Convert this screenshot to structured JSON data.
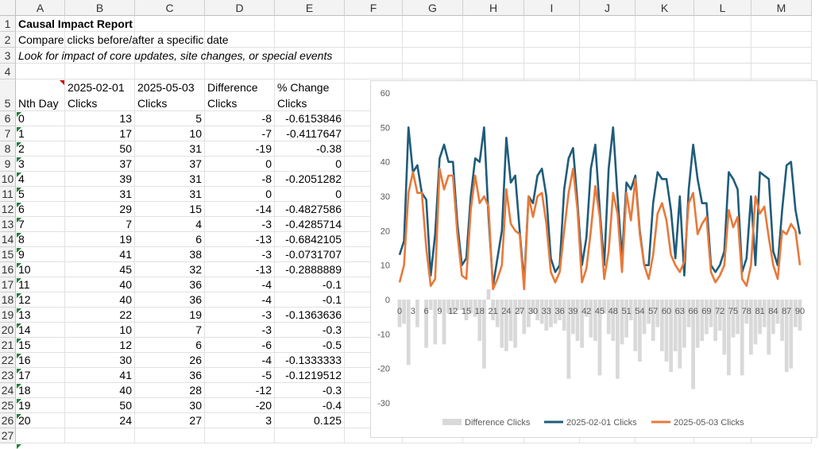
{
  "columns": [
    "A",
    "B",
    "C",
    "D",
    "E",
    "F",
    "G",
    "H",
    "I",
    "J",
    "K",
    "L",
    "M"
  ],
  "rows": {
    "title": "Causal Impact Report",
    "subtitle": "Compare clicks before/after a specific date",
    "note": "Look for impact of core updates, site changes, or special events"
  },
  "table": {
    "headers": [
      {
        "line1": "",
        "line2": "Nth Day"
      },
      {
        "line1": "2025-02-01",
        "line2": "Clicks"
      },
      {
        "line1": "2025-05-03",
        "line2": "Clicks"
      },
      {
        "line1": "Difference",
        "line2": "Clicks"
      },
      {
        "line1": "% Change",
        "line2": "Clicks"
      }
    ],
    "data": [
      [
        "0",
        "13",
        "5",
        "-8",
        "-0.6153846"
      ],
      [
        "1",
        "17",
        "10",
        "-7",
        "-0.4117647"
      ],
      [
        "2",
        "50",
        "31",
        "-19",
        "-0.38"
      ],
      [
        "3",
        "37",
        "37",
        "0",
        "0"
      ],
      [
        "4",
        "39",
        "31",
        "-8",
        "-0.2051282"
      ],
      [
        "5",
        "31",
        "31",
        "0",
        "0"
      ],
      [
        "6",
        "29",
        "15",
        "-14",
        "-0.4827586"
      ],
      [
        "7",
        "7",
        "4",
        "-3",
        "-0.4285714"
      ],
      [
        "8",
        "19",
        "6",
        "-13",
        "-0.6842105"
      ],
      [
        "9",
        "41",
        "38",
        "-3",
        "-0.0731707"
      ],
      [
        "10",
        "45",
        "32",
        "-13",
        "-0.2888889"
      ],
      [
        "11",
        "40",
        "36",
        "-4",
        "-0.1"
      ],
      [
        "12",
        "40",
        "36",
        "-4",
        "-0.1"
      ],
      [
        "13",
        "22",
        "19",
        "-3",
        "-0.1363636"
      ],
      [
        "14",
        "10",
        "7",
        "-3",
        "-0.3"
      ],
      [
        "15",
        "12",
        "6",
        "-6",
        "-0.5"
      ],
      [
        "16",
        "30",
        "26",
        "-4",
        "-0.1333333"
      ],
      [
        "17",
        "41",
        "36",
        "-5",
        "-0.1219512"
      ],
      [
        "18",
        "40",
        "28",
        "-12",
        "-0.3"
      ],
      [
        "19",
        "50",
        "30",
        "-20",
        "-0.4"
      ],
      [
        "20",
        "24",
        "27",
        "3",
        "0.125"
      ]
    ]
  },
  "colors": {
    "series_a": "#1f5c7a",
    "series_b": "#e8793a",
    "diff": "#d9d9d9",
    "green_marker": "#1a7f37",
    "red_marker": "#d00000"
  },
  "chart_data": {
    "type": "line",
    "ylim": [
      -30,
      60
    ],
    "yticks": [
      "60",
      "50",
      "40",
      "30",
      "20",
      "10",
      "0",
      "-10",
      "-20",
      "-30"
    ],
    "xticks": [
      "0",
      "3",
      "6",
      "9",
      "12",
      "15",
      "18",
      "21",
      "24",
      "27",
      "30",
      "33",
      "36",
      "39",
      "42",
      "45",
      "48",
      "51",
      "54",
      "57",
      "60",
      "63",
      "66",
      "69",
      "72",
      "75",
      "78",
      "81",
      "84",
      "87",
      "90"
    ],
    "x": [
      0,
      1,
      2,
      3,
      4,
      5,
      6,
      7,
      8,
      9,
      10,
      11,
      12,
      13,
      14,
      15,
      16,
      17,
      18,
      19,
      20,
      21,
      22,
      23,
      24,
      25,
      26,
      27,
      28,
      29,
      30,
      31,
      32,
      33,
      34,
      35,
      36,
      37,
      38,
      39,
      40,
      41,
      42,
      43,
      44,
      45,
      46,
      47,
      48,
      49,
      50,
      51,
      52,
      53,
      54,
      55,
      56,
      57,
      58,
      59,
      60,
      61,
      62,
      63,
      64,
      65,
      66,
      67,
      68,
      69,
      70,
      71,
      72,
      73,
      74,
      75,
      76,
      77,
      78,
      79,
      80,
      81,
      82,
      83,
      84,
      85,
      86,
      87,
      88,
      89,
      90
    ],
    "series": [
      {
        "name": "Difference Clicks",
        "type": "bar",
        "values": [
          -8,
          -7,
          -19,
          0,
          -8,
          0,
          -14,
          -3,
          -13,
          -3,
          -13,
          -4,
          -4,
          -3,
          -3,
          -6,
          -4,
          -5,
          -12,
          -20,
          3,
          -6,
          -8,
          -14,
          -15,
          -12,
          -14,
          -4,
          -10,
          -8,
          -4,
          -6,
          -7,
          -9,
          -8,
          -7,
          -6,
          -9,
          -23,
          -10,
          -12,
          -14,
          -5,
          -11,
          -12,
          -22,
          -4,
          -10,
          -12,
          -23,
          -13,
          -11,
          -6,
          -15,
          -18,
          -10,
          -7,
          -12,
          -8,
          -15,
          -18,
          -21,
          -15,
          -20,
          -14,
          -8,
          -26,
          -14,
          -12,
          -10,
          -8,
          -12,
          -9,
          -16,
          -22,
          -11,
          -10,
          -22,
          -7,
          -16,
          -13,
          -10,
          -8,
          -16,
          -10,
          -7,
          -12,
          -21,
          -20,
          -8,
          -9
        ]
      },
      {
        "name": "2025-02-01 Clicks",
        "type": "line",
        "values": [
          13,
          17,
          50,
          37,
          39,
          31,
          29,
          7,
          19,
          41,
          45,
          40,
          40,
          22,
          10,
          12,
          30,
          41,
          40,
          50,
          24,
          4,
          12,
          20,
          47,
          34,
          36,
          20,
          5,
          30,
          28,
          36,
          38,
          30,
          12,
          8,
          10,
          32,
          41,
          44,
          28,
          10,
          18,
          38,
          45,
          26,
          10,
          38,
          50,
          30,
          12,
          34,
          32,
          36,
          20,
          10,
          10,
          28,
          37,
          35,
          35,
          26,
          12,
          30,
          7,
          32,
          45,
          35,
          28,
          28,
          10,
          8,
          10,
          14,
          37,
          35,
          32,
          8,
          12,
          30,
          10,
          37,
          36,
          35,
          14,
          10,
          26,
          39,
          40,
          26,
          19
        ]
      },
      {
        "name": "2025-05-03 Clicks",
        "type": "line",
        "values": [
          5,
          10,
          31,
          37,
          31,
          31,
          15,
          4,
          6,
          38,
          32,
          36,
          36,
          19,
          7,
          6,
          26,
          36,
          28,
          30,
          27,
          3,
          6,
          10,
          32,
          22,
          20,
          19,
          3,
          30,
          24,
          30,
          31,
          22,
          8,
          5,
          8,
          20,
          31,
          38,
          26,
          5,
          9,
          20,
          33,
          24,
          6,
          14,
          31,
          25,
          8,
          31,
          23,
          35,
          19,
          10,
          6,
          13,
          25,
          28,
          23,
          13,
          10,
          8,
          11,
          28,
          31,
          19,
          22,
          24,
          8,
          5,
          7,
          10,
          26,
          21,
          24,
          6,
          4,
          10,
          30,
          25,
          27,
          18,
          10,
          6,
          20,
          19,
          22,
          20,
          10
        ]
      }
    ]
  }
}
